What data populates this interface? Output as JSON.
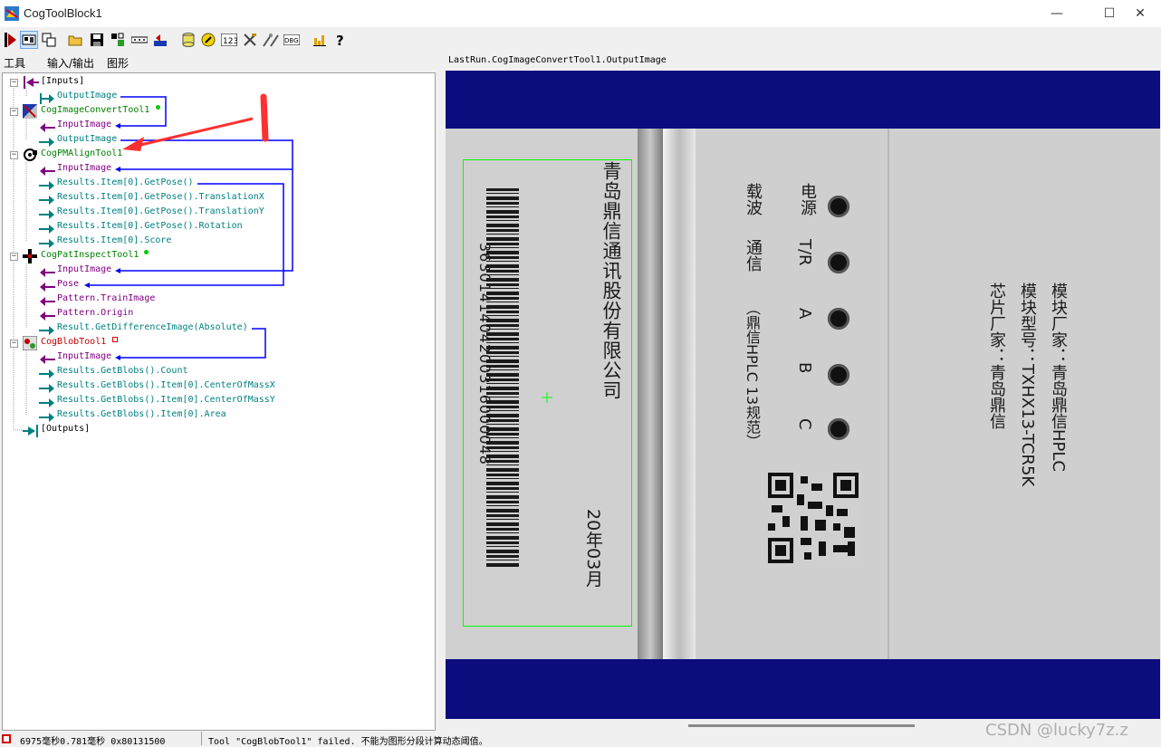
{
  "window": {
    "title": "CogToolBlock1",
    "minimize": "—",
    "maximize": "☐",
    "close": "✕"
  },
  "toolbar": {
    "icons": [
      "run-icon",
      "display-icon",
      "copy-icon",
      "open-icon",
      "save-icon",
      "tool-icon",
      "dots-icon",
      "reset-icon",
      "database-icon",
      "wizard-icon",
      "counter-icon",
      "tools-icon",
      "debug-icon",
      "chart-icon",
      "help-icon"
    ]
  },
  "tabs": [
    {
      "label": "工具"
    },
    {
      "label": "输入/输出"
    },
    {
      "label": "图形"
    }
  ],
  "tree": {
    "inputs": "[Inputs]",
    "inputs_output": "OutputImage",
    "convert_tool": "CogImageConvertTool1",
    "convert_input": "InputImage",
    "convert_output": "OutputImage",
    "pmalign_tool": "CogPMAlignTool1",
    "pmalign_input": "InputImage",
    "pm_pose": "Results.Item[0].GetPose()",
    "pm_tx": "Results.Item[0].GetPose().TranslationX",
    "pm_ty": "Results.Item[0].GetPose().TranslationY",
    "pm_rot": "Results.Item[0].GetPose().Rotation",
    "pm_score": "Results.Item[0].Score",
    "patinspect_tool": "CogPatInspectTool1",
    "pi_input": "InputImage",
    "pi_pose": "Pose",
    "pi_train": "Pattern.TrainImage",
    "pi_origin": "Pattern.Origin",
    "pi_diff": "Result.GetDifferenceImage(Absolute)",
    "blob_tool": "CogBlobTool1",
    "blob_input": "InputImage",
    "blob_count": "Results.GetBlobs().Count",
    "blob_cx": "Results.GetBlobs().Item[0].CenterOfMassX",
    "blob_cy": "Results.GetBlobs().Item[0].CenterOfMassY",
    "blob_area": "Results.GetBlobs().Item[0].Area",
    "outputs": "[Outputs]"
  },
  "viewer": {
    "label": "LastRun.CogImageConvertTool1.OutputImage",
    "label_text_top": "青岛鼎信通讯股份有限公司",
    "barcode_number": "3630141404200316000048",
    "date": "20年03月",
    "maker": "模块厂家：青岛鼎信HPLC",
    "model": "模块型号：TXHX13-TCR5K",
    "chip": "芯片厂家：青岛鼎信",
    "power": "电源",
    "tr": "T/R",
    "a": "A",
    "b": "B",
    "c": "C",
    "carrier": "载波",
    "comm": "通信",
    "standard": "（鼎信HPLC 13规范）"
  },
  "status": {
    "timing": "6975毫秒0.781毫秒 0x80131500",
    "message": "Tool \"CogBlobTool1\" failed. 不能为图形分段计算动态阈值。",
    "watermark": "CSDN @lucky7z.z"
  },
  "colors": {
    "teal": "#008080",
    "purple": "#800080",
    "link_blue": "#0000ff",
    "viewer_bg": "#0c0c7e",
    "roi_green": "#00ff00",
    "annotation_red": "#ff3030"
  }
}
